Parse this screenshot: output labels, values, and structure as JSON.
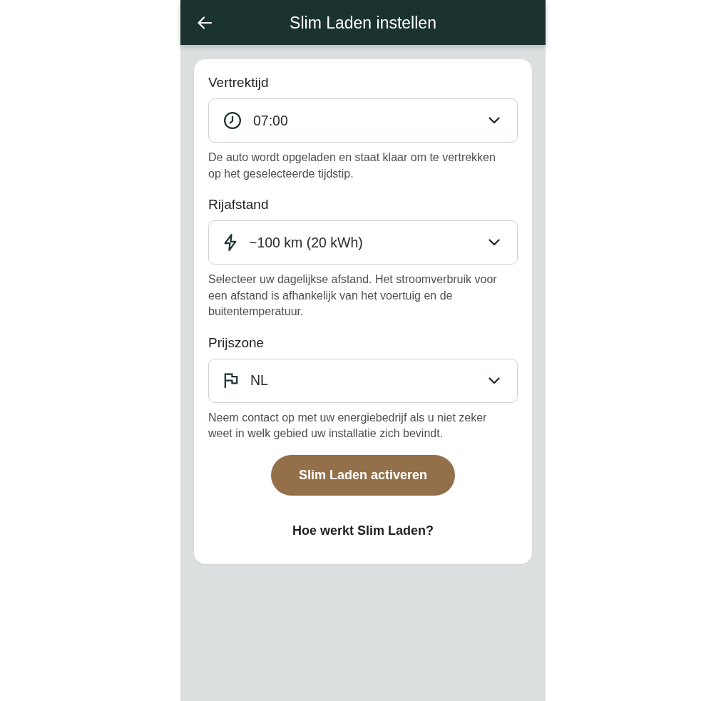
{
  "header": {
    "title": "Slim Laden instellen"
  },
  "fields": [
    {
      "label": "Vertrektijd",
      "kind": "clock",
      "value": "07:00",
      "help": "De auto wordt opgeladen en staat klaar om te vertrekken op het geselecteerde tijdstip."
    },
    {
      "label": "Rijafstand",
      "kind": "bolt",
      "value": "~100 km (20 kWh)",
      "help": "Selecteer uw dagelijkse afstand. Het stroomverbruik voor een afstand is afhankelijk van het voertuig en de buitentemperatuur."
    },
    {
      "label": "Prijszone",
      "kind": "flag",
      "value": "NL",
      "help": "Neem contact op met uw energiebedrijf als u niet zeker weet in welk gebied uw installatie zich bevindt."
    }
  ],
  "primary_button": "Slim Laden activeren",
  "help_link": "Hoe werkt Slim Laden?"
}
